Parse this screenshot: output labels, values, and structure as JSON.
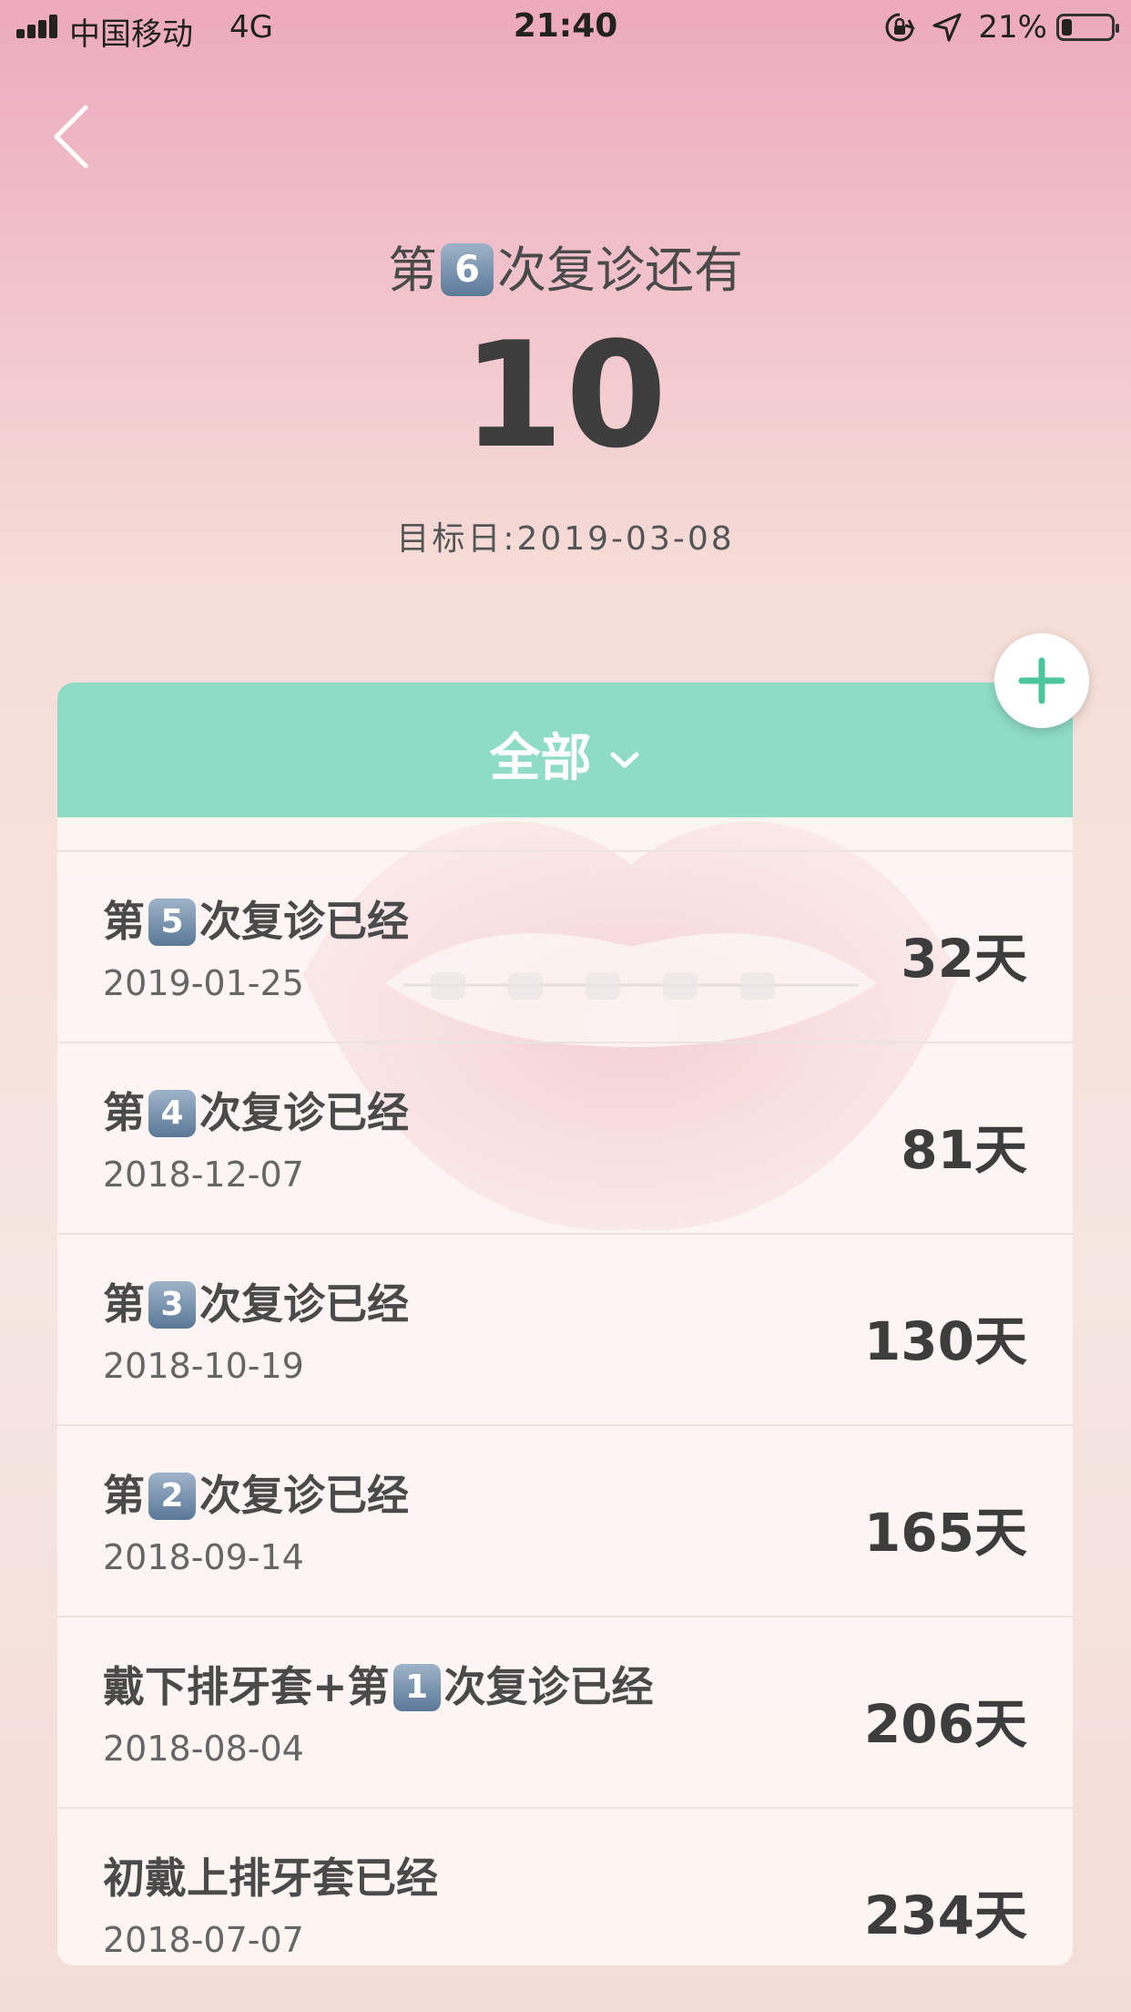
{
  "status_bar": {
    "carrier": "中国移动",
    "network": "4G",
    "time": "21:40",
    "battery_percent": "21%",
    "battery_level": 0.21
  },
  "header": {
    "title_before": "第",
    "visit_number": "6",
    "title_after": "次复诊还有",
    "countdown": "10",
    "target_date": "目标日:2019-03-08"
  },
  "filter": {
    "label": "全部"
  },
  "records": [
    {
      "prefix": "第",
      "badge": "5",
      "suffix": "次复诊已经",
      "date": "2019-01-25",
      "days": "32天"
    },
    {
      "prefix": "第",
      "badge": "4",
      "suffix": "次复诊已经",
      "date": "2018-12-07",
      "days": "81天"
    },
    {
      "prefix": "第",
      "badge": "3",
      "suffix": "次复诊已经",
      "date": "2018-10-19",
      "days": "130天"
    },
    {
      "prefix": "第",
      "badge": "2",
      "suffix": "次复诊已经",
      "date": "2018-09-14",
      "days": "165天"
    },
    {
      "prefix": "戴下排牙套+第",
      "badge": "1",
      "suffix": "次复诊已经",
      "date": "2018-08-04",
      "days": "206天"
    },
    {
      "prefix": "初戴上排牙套已经",
      "badge": "",
      "suffix": "",
      "date": "2018-07-07",
      "days": "234天"
    }
  ],
  "colors": {
    "accent": "#8fdcc6",
    "plus": "#4cc49c",
    "badge": "#6a88a6"
  },
  "icons": {
    "back": "chevron-left-icon",
    "dropdown": "chevron-down-icon",
    "add": "plus-icon",
    "orientation_lock": "orientation-lock-icon",
    "location": "location-arrow-icon",
    "watermark": "lips-braces-icon"
  }
}
